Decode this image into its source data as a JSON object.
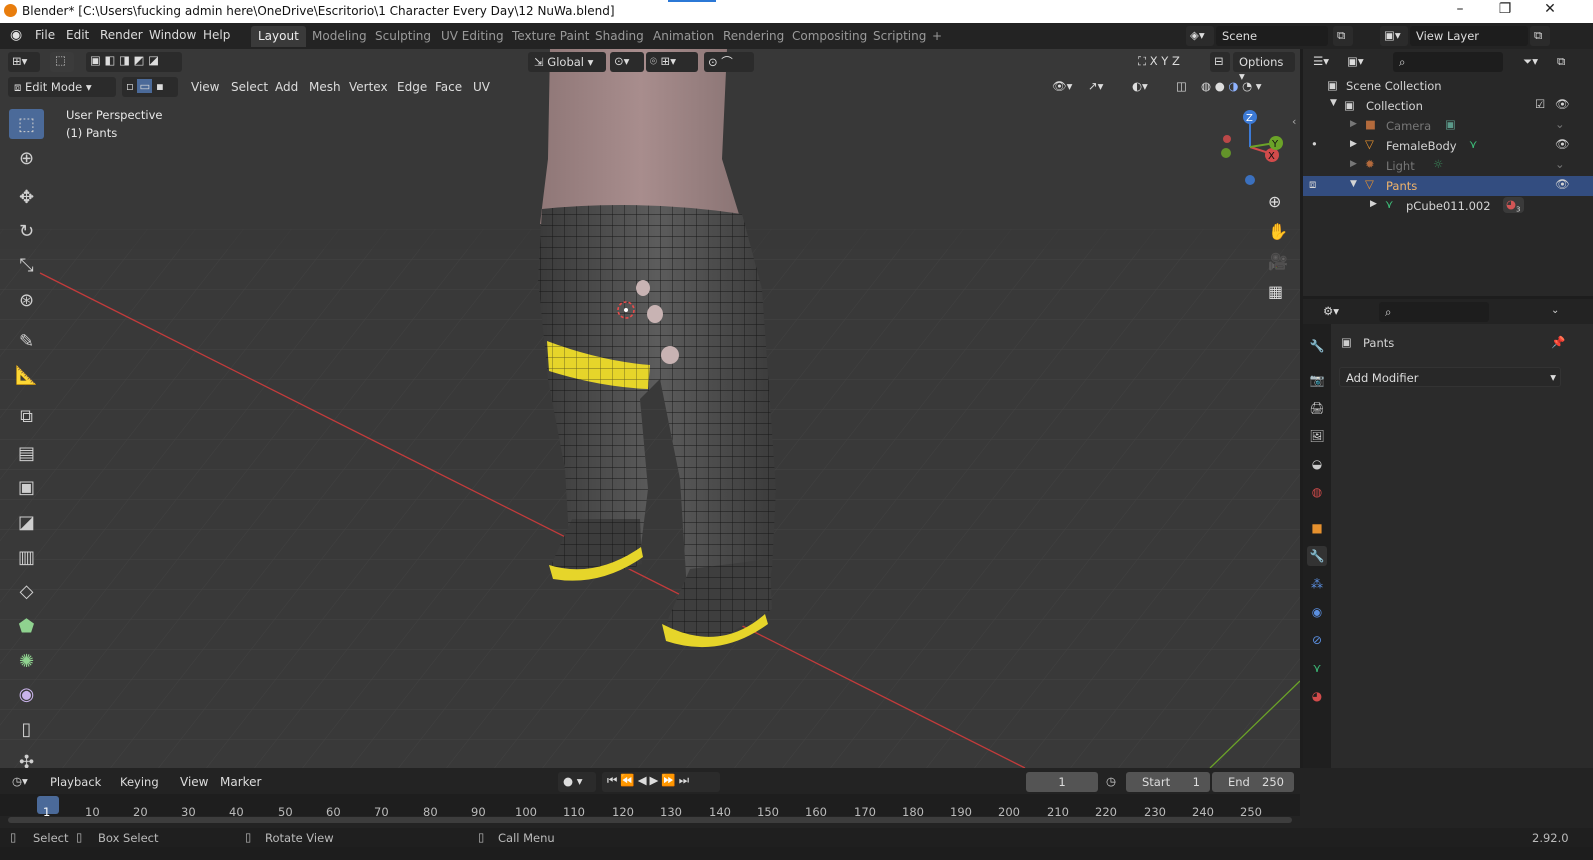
{
  "window": {
    "title": "Blender* [C:\\Users\\fucking admin here\\OneDrive\\Escritorio\\1 Character Every Day\\12 NuWa.blend]"
  },
  "menus": [
    "File",
    "Edit",
    "Render",
    "Window",
    "Help"
  ],
  "workspaces": [
    "Layout",
    "Modeling",
    "Sculpting",
    "UV Editing",
    "Texture Paint",
    "Shading",
    "Animation",
    "Rendering",
    "Compositing",
    "Scripting",
    "+"
  ],
  "active_workspace": "Layout",
  "scene": {
    "name": "Scene",
    "view_layer": "View Layer"
  },
  "viewport": {
    "mode": "Edit Mode",
    "header_menus": [
      "View",
      "Select",
      "Add",
      "Mesh",
      "Vertex",
      "Edge",
      "Face",
      "UV"
    ],
    "transform_orientation": "Global",
    "options_label": "Options",
    "axes_labels": [
      "X",
      "Y",
      "Z"
    ],
    "overlay_title": "User Perspective",
    "overlay_object": "(1) Pants",
    "gizmo": {
      "x": "X",
      "y": "Y",
      "z": "Z"
    }
  },
  "outliner": {
    "root": "Scene Collection",
    "collection": "Collection",
    "items": [
      {
        "name": "Camera",
        "icon": "camera-icon",
        "dim": true
      },
      {
        "name": "FemaleBody",
        "icon": "mesh-object-icon",
        "dim": false
      },
      {
        "name": "Light",
        "icon": "light-icon",
        "dim": true
      },
      {
        "name": "Pants",
        "icon": "mesh-object-icon",
        "dim": false,
        "selected": true
      },
      {
        "name": "pCube011.002",
        "icon": "mesh-data-icon",
        "child": true,
        "badge": "3"
      }
    ]
  },
  "properties": {
    "object_name": "Pants",
    "add_modifier": "Add Modifier"
  },
  "timeline": {
    "menus": [
      "Playback",
      "Keying",
      "View",
      "Marker"
    ],
    "current_frame": "1",
    "start_label": "Start",
    "start": "1",
    "end_label": "End",
    "end": "250",
    "ticks": [
      "1",
      "10",
      "20",
      "30",
      "40",
      "50",
      "60",
      "70",
      "80",
      "90",
      "100",
      "110",
      "120",
      "130",
      "140",
      "150",
      "160",
      "170",
      "180",
      "190",
      "200",
      "210",
      "220",
      "230",
      "240",
      "250"
    ]
  },
  "status": {
    "select": "Select",
    "box_select": "Box Select",
    "rotate": "Rotate View",
    "call_menu": "Call Menu",
    "version": "2.92.0"
  },
  "colors": {
    "accent": "#4b6a99",
    "selected_row": "#334d80",
    "pants_trim": "#e6d52a",
    "grid_x_axis": "#c33b3b",
    "grid_y_axis": "#6ba328"
  }
}
